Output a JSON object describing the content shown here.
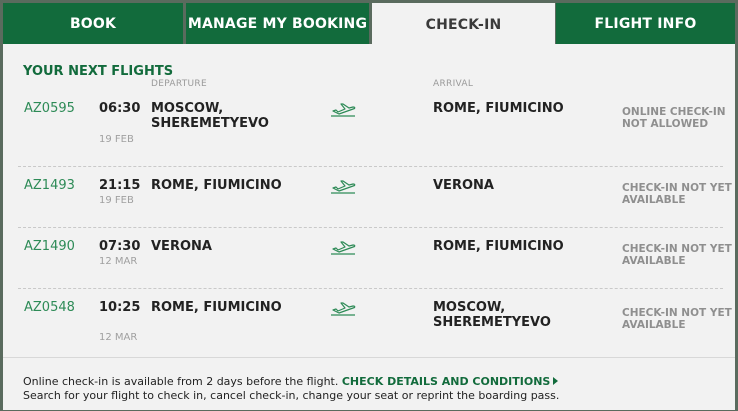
{
  "tabs": [
    {
      "label": "BOOK",
      "active": false
    },
    {
      "label": "MANAGE MY BOOKING",
      "active": false
    },
    {
      "label": "CHECK-IN",
      "active": true
    },
    {
      "label": "FLIGHT INFO",
      "active": false
    }
  ],
  "section_title": "YOUR NEXT FLIGHTS",
  "columns": {
    "departure": "DEPARTURE",
    "arrival": "ARRIVAL"
  },
  "flights": [
    {
      "flight_no": "AZ0595",
      "time": "06:30",
      "date": "19 FEB",
      "departure": "MOSCOW, SHEREMETYEVO",
      "arrival": "ROME, FIUMICINO",
      "status": "ONLINE CHECK-IN NOT ALLOWED",
      "icon": "plane-takeoff-icon"
    },
    {
      "flight_no": "AZ1493",
      "time": "21:15",
      "date": "19 FEB",
      "departure": "ROME, FIUMICINO",
      "arrival": "VERONA",
      "status": "CHECK-IN NOT YET AVAILABLE",
      "icon": "plane-takeoff-icon"
    },
    {
      "flight_no": "AZ1490",
      "time": "07:30",
      "date": "12 MAR",
      "departure": "VERONA",
      "arrival": "ROME, FIUMICINO",
      "status": "CHECK-IN NOT YET AVAILABLE",
      "icon": "plane-takeoff-icon"
    },
    {
      "flight_no": "AZ0548",
      "time": "10:25",
      "date": "12 MAR",
      "departure": "ROME, FIUMICINO",
      "arrival": "MOSCOW, SHEREMETYEVO",
      "status": "CHECK-IN NOT YET AVAILABLE",
      "icon": "plane-takeoff-icon"
    }
  ],
  "footer": {
    "line1": "Online check-in is available from 2 days before the flight.",
    "link": "CHECK DETAILS AND CONDITIONS",
    "line2": "Search for your flight to check in, cancel check-in, change your seat or reprint the boarding pass."
  },
  "colors": {
    "brand_green": "#126b3c",
    "panel_bg": "#f2f2f2",
    "status_gray": "#8f8f8f"
  }
}
